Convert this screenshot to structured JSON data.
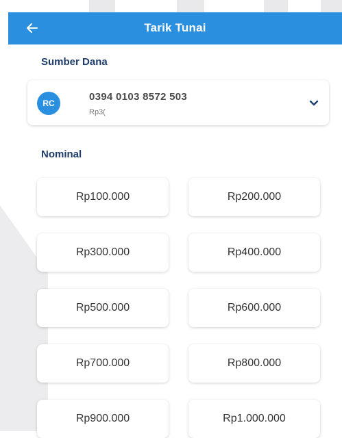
{
  "header": {
    "title": "Tarik Tunai",
    "back_icon": "arrow-left-icon"
  },
  "sumber_dana": {
    "label": "Sumber Dana",
    "account": {
      "avatar_initials": "RC",
      "number": "0394 0103 8572 503",
      "balance_prefix": "Rp3(",
      "dropdown_icon": "chevron-down-icon"
    }
  },
  "nominal": {
    "label": "Nominal",
    "options": [
      "Rp100.000",
      "Rp200.000",
      "Rp300.000",
      "Rp400.000",
      "Rp500.000",
      "Rp600.000",
      "Rp700.000",
      "Rp800.000",
      "Rp900.000",
      "Rp1.000.000"
    ]
  },
  "colors": {
    "primary": "#2b8fe0",
    "heading": "#1d3c6b"
  }
}
